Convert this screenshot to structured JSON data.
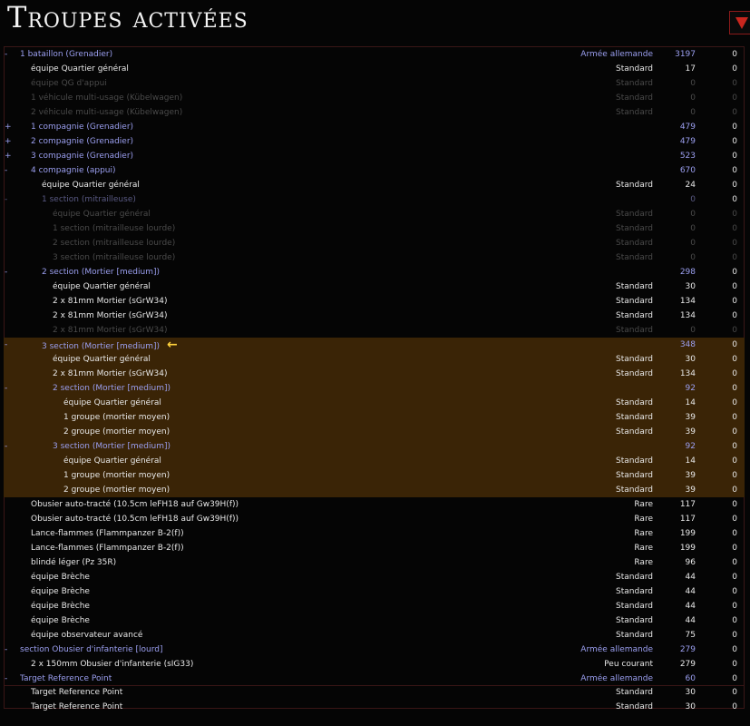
{
  "title": "Troupes activées",
  "collapse_icon": "triangle-down-icon",
  "colors": {
    "background": "#050505",
    "unit_text": "#9b9ff0",
    "highlight": "#3a2406",
    "disabled_text": "#4a4a4a",
    "arrow": "#ffd23c",
    "accent_red": "#c8261e"
  },
  "rows": [
    {
      "toggle": "-",
      "name": "1 bataillon (Grenadier)",
      "type": "Armée allemande",
      "cost": "3197",
      "extra": "0",
      "indent": 0,
      "unit": true,
      "disabled": false,
      "hl": false
    },
    {
      "toggle": "",
      "name": "équipe Quartier général",
      "type": "Standard",
      "cost": "17",
      "extra": "0",
      "indent": 1,
      "unit": false,
      "disabled": false,
      "hl": false
    },
    {
      "toggle": "",
      "name": "équipe QG d'appui",
      "type": "Standard",
      "cost": "0",
      "extra": "0",
      "indent": 1,
      "unit": false,
      "disabled": true,
      "hl": false
    },
    {
      "toggle": "",
      "name": "1 véhicule multi-usage (Kübelwagen)",
      "type": "Standard",
      "cost": "0",
      "extra": "0",
      "indent": 1,
      "unit": false,
      "disabled": true,
      "hl": false
    },
    {
      "toggle": "",
      "name": "2 véhicule multi-usage (Kübelwagen)",
      "type": "Standard",
      "cost": "0",
      "extra": "0",
      "indent": 1,
      "unit": false,
      "disabled": true,
      "hl": false
    },
    {
      "toggle": "+",
      "name": "1 compagnie (Grenadier)",
      "type": "",
      "cost": "479",
      "extra": "0",
      "indent": 1,
      "unit": true,
      "disabled": false,
      "hl": false
    },
    {
      "toggle": "+",
      "name": "2 compagnie (Grenadier)",
      "type": "",
      "cost": "479",
      "extra": "0",
      "indent": 1,
      "unit": true,
      "disabled": false,
      "hl": false
    },
    {
      "toggle": "+",
      "name": "3 compagnie (Grenadier)",
      "type": "",
      "cost": "523",
      "extra": "0",
      "indent": 1,
      "unit": true,
      "disabled": false,
      "hl": false
    },
    {
      "toggle": "-",
      "name": "4 compagnie (appui)",
      "type": "",
      "cost": "670",
      "extra": "0",
      "indent": 1,
      "unit": true,
      "disabled": false,
      "hl": false
    },
    {
      "toggle": "",
      "name": "équipe Quartier général",
      "type": "Standard",
      "cost": "24",
      "extra": "0",
      "indent": 2,
      "unit": false,
      "disabled": false,
      "hl": false
    },
    {
      "toggle": "-",
      "name": "1 section (mitrailleuse)",
      "type": "",
      "cost": "0",
      "extra": "0",
      "indent": 2,
      "unit": true,
      "disabled": true,
      "hl": false
    },
    {
      "toggle": "",
      "name": "équipe Quartier général",
      "type": "Standard",
      "cost": "0",
      "extra": "0",
      "indent": 3,
      "unit": false,
      "disabled": true,
      "hl": false
    },
    {
      "toggle": "",
      "name": "1 section (mitrailleuse lourde)",
      "type": "Standard",
      "cost": "0",
      "extra": "0",
      "indent": 3,
      "unit": false,
      "disabled": true,
      "hl": false
    },
    {
      "toggle": "",
      "name": "2 section (mitrailleuse lourde)",
      "type": "Standard",
      "cost": "0",
      "extra": "0",
      "indent": 3,
      "unit": false,
      "disabled": true,
      "hl": false
    },
    {
      "toggle": "",
      "name": "3 section (mitrailleuse lourde)",
      "type": "Standard",
      "cost": "0",
      "extra": "0",
      "indent": 3,
      "unit": false,
      "disabled": true,
      "hl": false
    },
    {
      "toggle": "-",
      "name": "2 section (Mortier [medium])",
      "type": "",
      "cost": "298",
      "extra": "0",
      "indent": 2,
      "unit": true,
      "disabled": false,
      "hl": false
    },
    {
      "toggle": "",
      "name": "équipe Quartier général",
      "type": "Standard",
      "cost": "30",
      "extra": "0",
      "indent": 3,
      "unit": false,
      "disabled": false,
      "hl": false
    },
    {
      "toggle": "",
      "name": "2 x 81mm Mortier (sGrW34)",
      "type": "Standard",
      "cost": "134",
      "extra": "0",
      "indent": 3,
      "unit": false,
      "disabled": false,
      "hl": false
    },
    {
      "toggle": "",
      "name": "2 x 81mm Mortier (sGrW34)",
      "type": "Standard",
      "cost": "134",
      "extra": "0",
      "indent": 3,
      "unit": false,
      "disabled": false,
      "hl": false
    },
    {
      "toggle": "",
      "name": "2 x 81mm Mortier (sGrW34)",
      "type": "Standard",
      "cost": "0",
      "extra": "0",
      "indent": 3,
      "unit": false,
      "disabled": true,
      "hl": false
    },
    {
      "toggle": "-",
      "name": "3 section (Mortier [medium])",
      "type": "",
      "cost": "348",
      "extra": "0",
      "indent": 2,
      "unit": true,
      "disabled": false,
      "hl": true,
      "arrow": true
    },
    {
      "toggle": "",
      "name": "équipe Quartier général",
      "type": "Standard",
      "cost": "30",
      "extra": "0",
      "indent": 3,
      "unit": false,
      "disabled": false,
      "hl": true
    },
    {
      "toggle": "",
      "name": "2 x 81mm Mortier (sGrW34)",
      "type": "Standard",
      "cost": "134",
      "extra": "0",
      "indent": 3,
      "unit": false,
      "disabled": false,
      "hl": true
    },
    {
      "toggle": "-",
      "name": "2 section (Mortier [medium])",
      "type": "",
      "cost": "92",
      "extra": "0",
      "indent": 3,
      "unit": true,
      "disabled": false,
      "hl": true
    },
    {
      "toggle": "",
      "name": "équipe Quartier général",
      "type": "Standard",
      "cost": "14",
      "extra": "0",
      "indent": 4,
      "unit": false,
      "disabled": false,
      "hl": true
    },
    {
      "toggle": "",
      "name": "1 groupe (mortier moyen)",
      "type": "Standard",
      "cost": "39",
      "extra": "0",
      "indent": 4,
      "unit": false,
      "disabled": false,
      "hl": true
    },
    {
      "toggle": "",
      "name": "2 groupe (mortier moyen)",
      "type": "Standard",
      "cost": "39",
      "extra": "0",
      "indent": 4,
      "unit": false,
      "disabled": false,
      "hl": true
    },
    {
      "toggle": "-",
      "name": "3 section (Mortier [medium])",
      "type": "",
      "cost": "92",
      "extra": "0",
      "indent": 3,
      "unit": true,
      "disabled": false,
      "hl": true
    },
    {
      "toggle": "",
      "name": "équipe Quartier général",
      "type": "Standard",
      "cost": "14",
      "extra": "0",
      "indent": 4,
      "unit": false,
      "disabled": false,
      "hl": true
    },
    {
      "toggle": "",
      "name": "1 groupe (mortier moyen)",
      "type": "Standard",
      "cost": "39",
      "extra": "0",
      "indent": 4,
      "unit": false,
      "disabled": false,
      "hl": true
    },
    {
      "toggle": "",
      "name": "2 groupe (mortier moyen)",
      "type": "Standard",
      "cost": "39",
      "extra": "0",
      "indent": 4,
      "unit": false,
      "disabled": false,
      "hl": true
    },
    {
      "toggle": "",
      "name": "Obusier auto-tracté (10.5cm leFH18 auf Gw39H(f))",
      "type": "Rare",
      "cost": "117",
      "extra": "0",
      "indent": 1,
      "unit": false,
      "disabled": false,
      "hl": false
    },
    {
      "toggle": "",
      "name": "Obusier auto-tracté (10.5cm leFH18 auf Gw39H(f))",
      "type": "Rare",
      "cost": "117",
      "extra": "0",
      "indent": 1,
      "unit": false,
      "disabled": false,
      "hl": false
    },
    {
      "toggle": "",
      "name": "Lance-flammes (Flammpanzer B-2(f))",
      "type": "Rare",
      "cost": "199",
      "extra": "0",
      "indent": 1,
      "unit": false,
      "disabled": false,
      "hl": false
    },
    {
      "toggle": "",
      "name": "Lance-flammes (Flammpanzer B-2(f))",
      "type": "Rare",
      "cost": "199",
      "extra": "0",
      "indent": 1,
      "unit": false,
      "disabled": false,
      "hl": false
    },
    {
      "toggle": "",
      "name": "blindé léger (Pz 35R)",
      "type": "Rare",
      "cost": "96",
      "extra": "0",
      "indent": 1,
      "unit": false,
      "disabled": false,
      "hl": false
    },
    {
      "toggle": "",
      "name": "équipe Brèche",
      "type": "Standard",
      "cost": "44",
      "extra": "0",
      "indent": 1,
      "unit": false,
      "disabled": false,
      "hl": false
    },
    {
      "toggle": "",
      "name": "équipe Brèche",
      "type": "Standard",
      "cost": "44",
      "extra": "0",
      "indent": 1,
      "unit": false,
      "disabled": false,
      "hl": false
    },
    {
      "toggle": "",
      "name": "équipe Brèche",
      "type": "Standard",
      "cost": "44",
      "extra": "0",
      "indent": 1,
      "unit": false,
      "disabled": false,
      "hl": false
    },
    {
      "toggle": "",
      "name": "équipe Brèche",
      "type": "Standard",
      "cost": "44",
      "extra": "0",
      "indent": 1,
      "unit": false,
      "disabled": false,
      "hl": false
    },
    {
      "toggle": "",
      "name": "équipe observateur avancé",
      "type": "Standard",
      "cost": "75",
      "extra": "0",
      "indent": 1,
      "unit": false,
      "disabled": false,
      "hl": false
    },
    {
      "toggle": "-",
      "name": "section Obusier d'infanterie [lourd]",
      "type": "Armée allemande",
      "cost": "279",
      "extra": "0",
      "indent": 0,
      "unit": true,
      "disabled": false,
      "hl": false
    },
    {
      "toggle": "",
      "name": "2 x 150mm Obusier d'infanterie (sIG33)",
      "type": "Peu courant",
      "cost": "279",
      "extra": "0",
      "indent": 1,
      "unit": false,
      "disabled": false,
      "hl": false
    },
    {
      "toggle": "-",
      "name": "Target Reference Point",
      "type": "Armée allemande",
      "cost": "60",
      "extra": "0",
      "indent": 0,
      "unit": true,
      "disabled": false,
      "hl": false
    }
  ],
  "tail_rows": [
    {
      "toggle": "",
      "name": "Target Reference Point",
      "type": "Standard",
      "cost": "30",
      "extra": "0",
      "indent": 1,
      "unit": false,
      "disabled": false,
      "hl": false
    },
    {
      "toggle": "",
      "name": "Target Reference Point",
      "type": "Standard",
      "cost": "30",
      "extra": "0",
      "indent": 1,
      "unit": false,
      "disabled": false,
      "hl": false
    }
  ]
}
